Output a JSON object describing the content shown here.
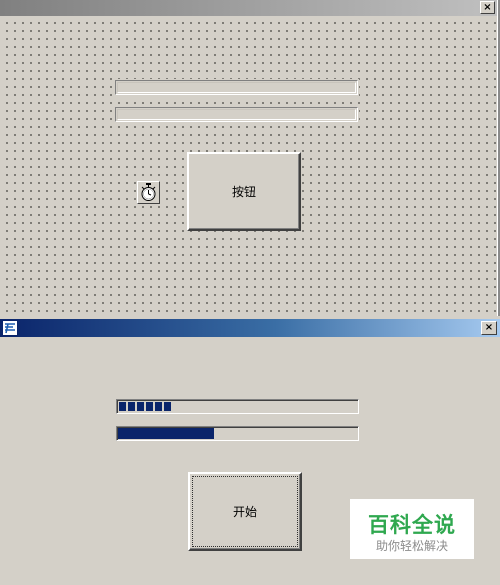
{
  "designer": {
    "close_glyph": "×",
    "button_label": "按钮",
    "timer_icon": "stopwatch-icon"
  },
  "runtime": {
    "app_icon": "app-icon",
    "close_glyph": "×",
    "segmented_progress": {
      "filled_segments": 6,
      "max_segments": 27
    },
    "solid_progress": {
      "fraction": 0.4
    },
    "start_button_label": "开始"
  },
  "watermark": {
    "title": "百科全说",
    "subtitle": "助你轻松解决"
  },
  "colors": {
    "titlebar_active_start": "#0a246a",
    "titlebar_active_end": "#a6caf0",
    "progress_fill": "#0a246a",
    "face": "#d4d0c8",
    "watermark_green": "#2fa84f"
  }
}
